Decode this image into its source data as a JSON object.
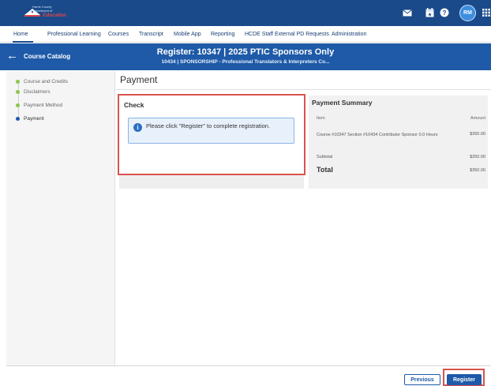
{
  "header": {
    "logo_county": "Harris County",
    "logo_dept": "Department of",
    "logo_education": "Education",
    "icons": [
      "mail-icon",
      "calendar-icon",
      "help-icon",
      "apps-grid-icon"
    ],
    "user_initials": "RM"
  },
  "nav": {
    "items": [
      "Home",
      "Professional Learning",
      "Courses",
      "Transcript",
      "Mobile App",
      "Reporting",
      "HCDE Staff External PD Requests",
      "Administration"
    ],
    "active": "Home"
  },
  "course_header": {
    "back_label": "Course Catalog",
    "title": "Register: 10347 | 2025 PTIC Sponsors Only",
    "subtitle": "10434 | SPONSORSHIP - Professional Translators & Interpreters Co..."
  },
  "steps": [
    {
      "label": "Course and Credits",
      "status": "complete"
    },
    {
      "label": "Disclaimers",
      "status": "complete"
    },
    {
      "label": "Payment Method",
      "status": "complete"
    },
    {
      "label": "Payment",
      "status": "current"
    }
  ],
  "main": {
    "page_title": "Payment",
    "check_title": "Check",
    "info_message": "Please click \"Register\" to complete registration."
  },
  "summary": {
    "title": "Payment Summary",
    "item_header": "Item",
    "amount_header": "Amount",
    "line_description": "Course #10347 Section #10434 Contributor Sponsor 0.0 Hours",
    "line_amount": "$350.00",
    "subtotal_label": "Subtotal",
    "subtotal_amount": "$350.00",
    "total_label": "Total",
    "total_amount": "$350.00"
  },
  "footer": {
    "previous_label": "Previous",
    "register_label": "Register"
  },
  "colors": {
    "topbar": "#1a4a8a",
    "course_header": "#1e5aa8",
    "highlight": "#d9534f",
    "complete_step": "#8dc64a"
  }
}
